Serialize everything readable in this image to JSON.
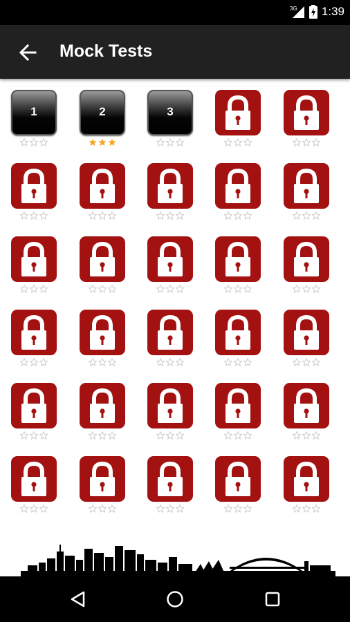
{
  "status_bar": {
    "time": "1:39",
    "network_label": "3G",
    "icons": [
      "signal-icon",
      "battery-icon"
    ]
  },
  "app_bar": {
    "title": "Mock Tests",
    "back_icon": "arrow-left-icon"
  },
  "tests": [
    {
      "number": "1",
      "locked": false,
      "stars": 0
    },
    {
      "number": "2",
      "locked": false,
      "stars": 3
    },
    {
      "number": "3",
      "locked": false,
      "stars": 0
    },
    {
      "locked": true,
      "stars": 0
    },
    {
      "locked": true,
      "stars": 0
    },
    {
      "locked": true,
      "stars": 0
    },
    {
      "locked": true,
      "stars": 0
    },
    {
      "locked": true,
      "stars": 0
    },
    {
      "locked": true,
      "stars": 0
    },
    {
      "locked": true,
      "stars": 0
    },
    {
      "locked": true,
      "stars": 0
    },
    {
      "locked": true,
      "stars": 0
    },
    {
      "locked": true,
      "stars": 0
    },
    {
      "locked": true,
      "stars": 0
    },
    {
      "locked": true,
      "stars": 0
    },
    {
      "locked": true,
      "stars": 0
    },
    {
      "locked": true,
      "stars": 0
    },
    {
      "locked": true,
      "stars": 0
    },
    {
      "locked": true,
      "stars": 0
    },
    {
      "locked": true,
      "stars": 0
    },
    {
      "locked": true,
      "stars": 0
    },
    {
      "locked": true,
      "stars": 0
    },
    {
      "locked": true,
      "stars": 0
    },
    {
      "locked": true,
      "stars": 0
    },
    {
      "locked": true,
      "stars": 0
    },
    {
      "locked": true,
      "stars": 0
    },
    {
      "locked": true,
      "stars": 0
    },
    {
      "locked": true,
      "stars": 0
    },
    {
      "locked": true,
      "stars": 0
    },
    {
      "locked": true,
      "stars": 0
    }
  ],
  "colors": {
    "lock_red": "#a31111",
    "star_filled": "#f5a623",
    "star_empty": "#cccccc",
    "app_bar": "#212121"
  },
  "nav_bar": {
    "buttons": [
      "back-triangle-icon",
      "home-circle-icon",
      "recents-square-icon"
    ]
  }
}
